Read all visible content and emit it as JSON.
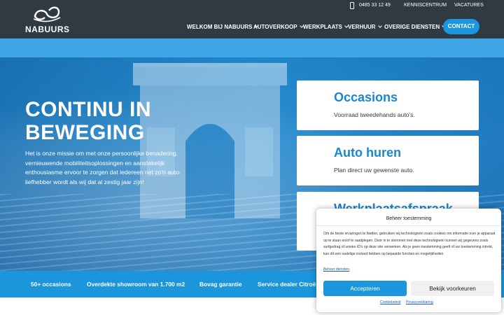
{
  "brand": {
    "logo_text": "NABUURS"
  },
  "topbar": {
    "phone": "0485 33 12 49",
    "kenniscentrum": "KENNISCENTRUM",
    "vacatures": "VACATURES"
  },
  "nav": {
    "items": [
      {
        "label": "WELKOM BIJ NABUURS"
      },
      {
        "label": "AUTOVERKOOP"
      },
      {
        "label": "WERKPLAATS"
      },
      {
        "label": "VERHUUR"
      },
      {
        "label": "OVERIGE DIENSTEN"
      }
    ],
    "contact_label": "CONTACT"
  },
  "hero": {
    "title": "CONTINU IN BEWEGING",
    "text": "Het is onze missie om met onze persoonlijke benadering, vernieuwende mobiliteitsoplossingen en aanstekelijk enthousiasme ervoor te zorgen dat iedereen net zo'n auto-liefhebber wordt als wij dat al zestig jaar zijn!"
  },
  "cards": [
    {
      "title": "Occasions",
      "subtitle": "Voorraad tweedehands auto's."
    },
    {
      "title": "Auto huren",
      "subtitle": "Plan direct uw gewenste auto."
    },
    {
      "title": "Werkplaatsafspraak",
      "subtitle": ""
    }
  ],
  "usp": [
    {
      "label": "50+ occasions"
    },
    {
      "label": "Overdekte showroom van 1.700 m2"
    },
    {
      "label": "Bovag garantie"
    },
    {
      "label": "Service dealer Citroën"
    }
  ],
  "cookie": {
    "title": "Beheer toestemming",
    "body": "Om de beste ervaringen te bieden, gebruiken wij technologieën zoals cookies om informatie over je apparaat op te slaan en/of te raadplegen. Door in te stemmen met deze technologieën kunnen wij gegevens zoals surfgedrag of unieke ID's op deze site verwerken. Als je geen toestemming geeft of uw toestemming intrekt, kan dit een nadelige invloed hebben op bepaalde functies en mogelijkheden.",
    "manage_link": "Beheer diensten",
    "accept": "Accepteren",
    "preferences": "Bekijk voorkeuren",
    "cookie_policy": "Cookiebeleid",
    "privacy": "Privacyverklaring"
  },
  "colors": {
    "header": "#2f3a42",
    "accent": "#1b95dc",
    "card_title": "#1a86cf"
  }
}
